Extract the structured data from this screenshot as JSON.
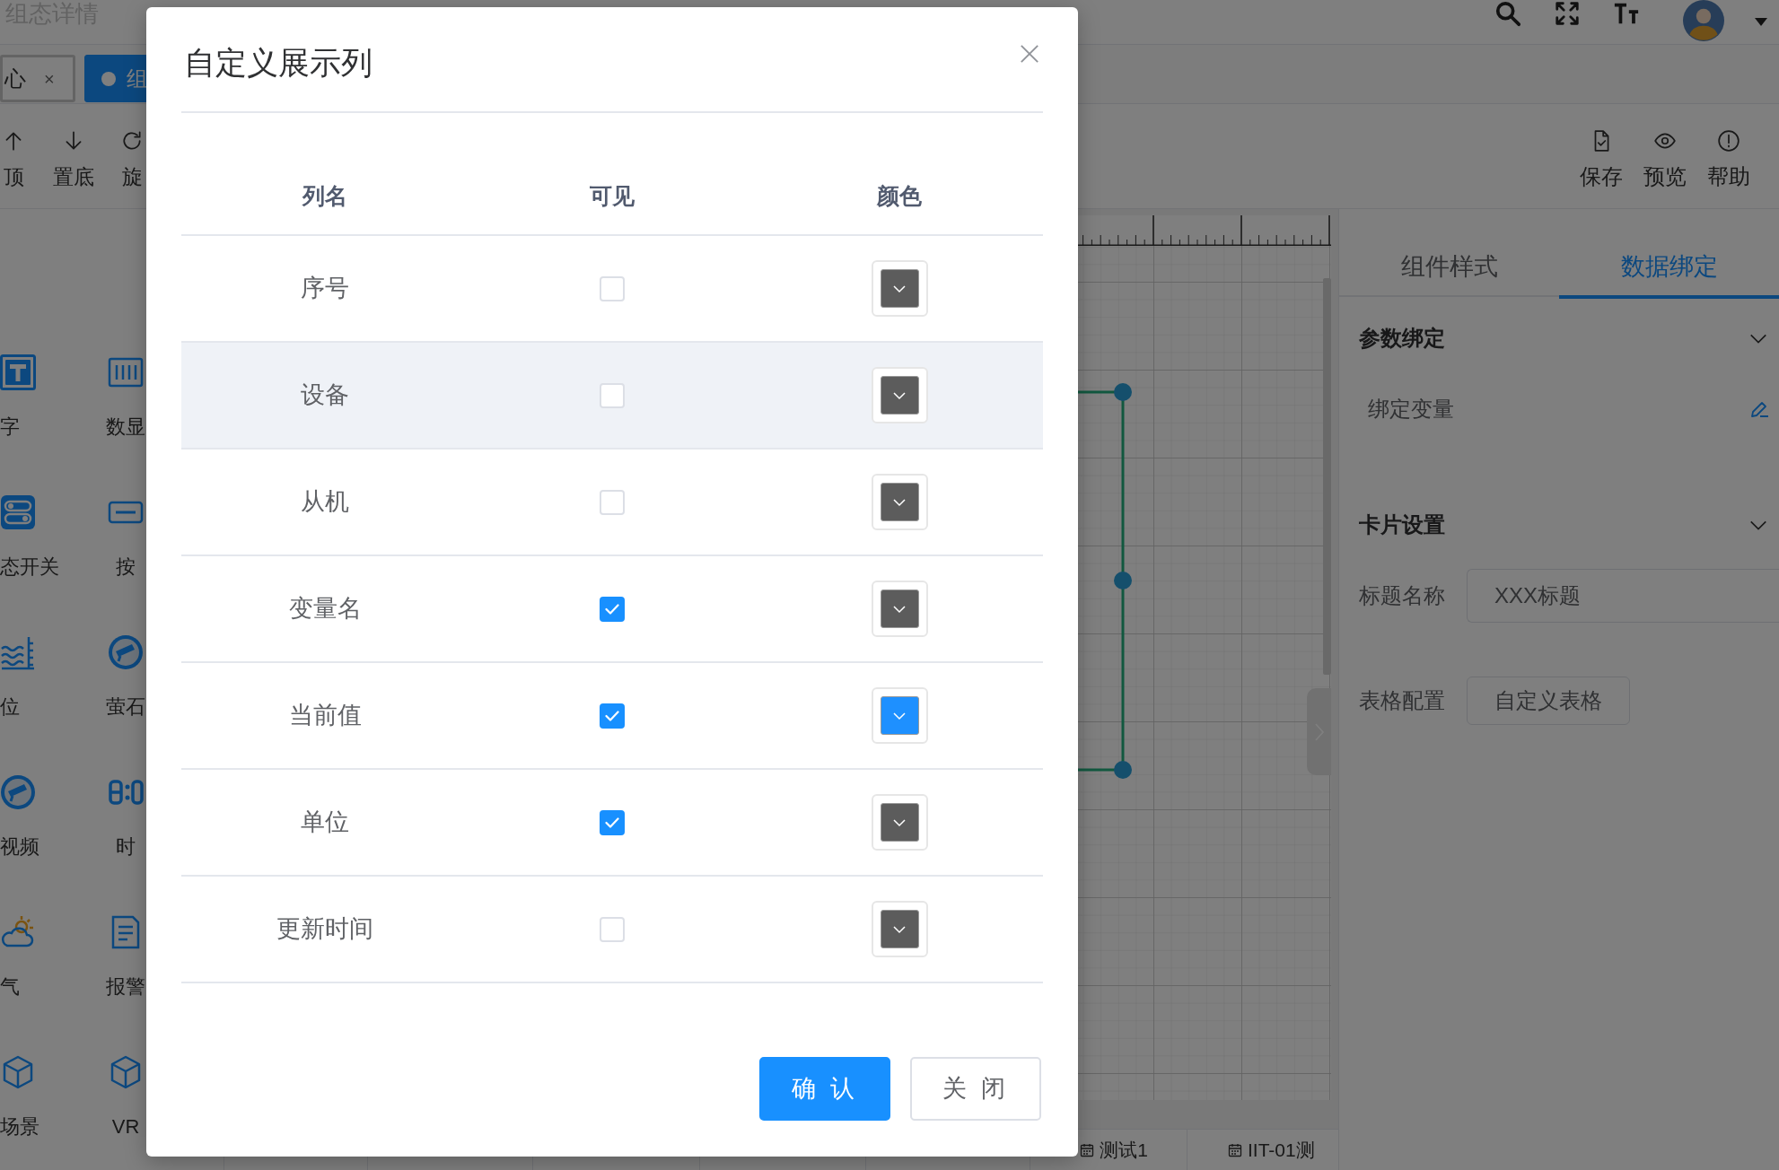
{
  "header": {
    "title": "组态详情"
  },
  "tabs": [
    {
      "label": "心",
      "close": "×",
      "selected": false
    },
    {
      "label": "组",
      "selected": true
    }
  ],
  "toolbar": {
    "left": [
      {
        "label": "顶"
      },
      {
        "label": "置底"
      },
      {
        "label": "旋"
      }
    ],
    "right": [
      {
        "label": "保存"
      },
      {
        "label": "预览"
      },
      {
        "label": "帮助"
      }
    ]
  },
  "components": [
    {
      "label": "字"
    },
    {
      "label": "数显"
    },
    {
      "label": "态开关"
    },
    {
      "label": "按"
    },
    {
      "label": "位"
    },
    {
      "label": "萤石"
    },
    {
      "label": "视频"
    },
    {
      "label": "时"
    },
    {
      "label": "气"
    },
    {
      "label": "报警"
    },
    {
      "label": "场景"
    },
    {
      "label": "VR"
    }
  ],
  "bottom_tabs": [
    {
      "label": "测试1"
    },
    {
      "label": "IIT-01测"
    }
  ],
  "right_panel": {
    "tabs": [
      {
        "label": "组件样式",
        "selected": false
      },
      {
        "label": "数据绑定",
        "selected": true
      }
    ],
    "sections": [
      {
        "title": "参数绑定",
        "expanded": true,
        "rows": [
          {
            "kind": "edit",
            "label": "绑定变量"
          }
        ]
      },
      {
        "title": "卡片设置",
        "expanded": true,
        "rows": [
          {
            "kind": "input",
            "label": "标题名称",
            "value": "XXX标题"
          },
          {
            "kind": "button",
            "label": "表格配置",
            "button": "自定义表格"
          }
        ]
      }
    ]
  },
  "dialog": {
    "title": "自定义展示列",
    "columns": [
      "列名",
      "可见",
      "颜色"
    ],
    "rows": [
      {
        "name": "序号",
        "visible": false,
        "color": "#5c5c5c",
        "highlighted": false
      },
      {
        "name": "设备",
        "visible": false,
        "color": "#5c5c5c",
        "highlighted": true
      },
      {
        "name": "从机",
        "visible": false,
        "color": "#5c5c5c",
        "highlighted": false
      },
      {
        "name": "变量名",
        "visible": true,
        "color": "#5c5c5c",
        "highlighted": false
      },
      {
        "name": "当前值",
        "visible": true,
        "color": "#1e90ff",
        "highlighted": false
      },
      {
        "name": "单位",
        "visible": true,
        "color": "#5c5c5c",
        "highlighted": false
      },
      {
        "name": "更新时间",
        "visible": false,
        "color": "#5c5c5c",
        "highlighted": false
      }
    ],
    "buttons": [
      {
        "kind": "primary",
        "label": "确 认"
      },
      {
        "kind": "default",
        "label": "关 闭"
      }
    ]
  }
}
